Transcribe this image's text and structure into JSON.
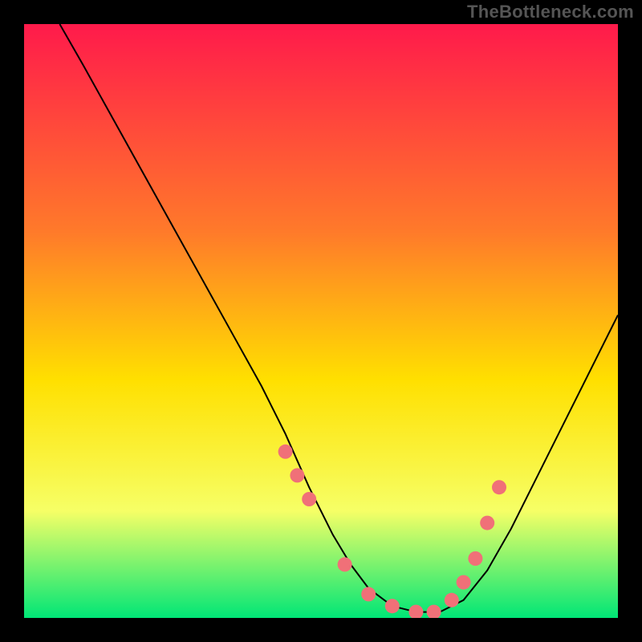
{
  "watermark": "TheBottleneck.com",
  "chart_data": {
    "type": "line",
    "title": "",
    "xlabel": "",
    "ylabel": "",
    "xlim": [
      0,
      100
    ],
    "ylim": [
      0,
      100
    ],
    "grid": false,
    "legend": false,
    "gradient": {
      "top": "#ff1a4b",
      "mid1": "#ff7a2a",
      "mid2": "#ffe000",
      "mid3": "#f6ff66",
      "bottom": "#00e676"
    },
    "series": [
      {
        "name": "curve",
        "color": "#000000",
        "x": [
          6,
          10,
          15,
          20,
          25,
          30,
          35,
          40,
          44,
          48,
          52,
          55,
          58,
          62,
          66,
          70,
          74,
          78,
          82,
          86,
          90,
          94,
          98,
          100
        ],
        "y": [
          100,
          93,
          84,
          75,
          66,
          57,
          48,
          39,
          31,
          22,
          14,
          9,
          5,
          2,
          1,
          1,
          3,
          8,
          15,
          23,
          31,
          39,
          47,
          51
        ]
      }
    ],
    "markers": [
      {
        "name": "dots",
        "color": "#f07078",
        "radius": 9,
        "x": [
          44,
          46,
          48,
          54,
          58,
          62,
          66,
          69,
          72,
          74,
          76,
          78,
          80
        ],
        "y": [
          28,
          24,
          20,
          9,
          4,
          2,
          1,
          1,
          3,
          6,
          10,
          16,
          22
        ]
      }
    ]
  }
}
